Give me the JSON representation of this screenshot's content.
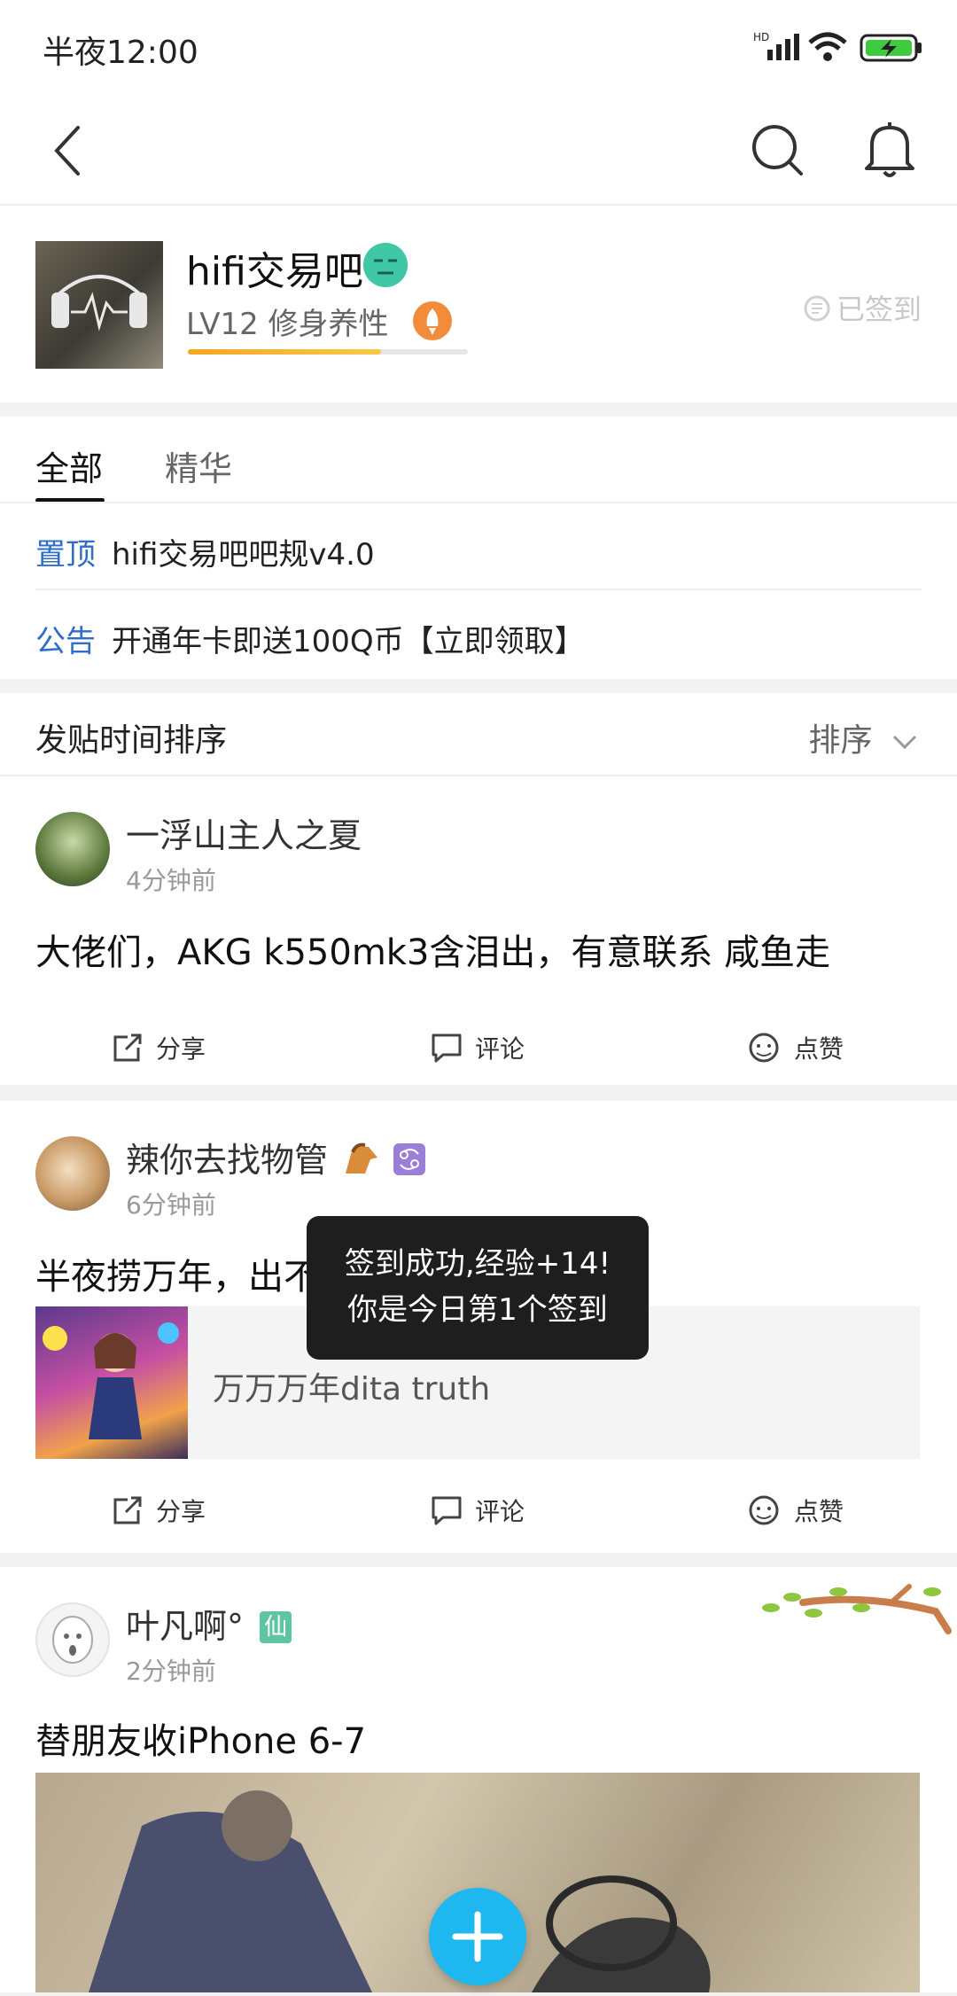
{
  "status": {
    "time": "半夜12:00"
  },
  "forum": {
    "name": "hifi交易吧",
    "level": "LV12 修身养性",
    "signed_label": "已签到"
  },
  "tabs": [
    {
      "label": "全部"
    },
    {
      "label": "精华"
    }
  ],
  "notices": [
    {
      "tag": "置顶",
      "text": "hifi交易吧吧规v4.0"
    },
    {
      "tag": "公告",
      "text": "开通年卡即送100Q币【立即领取】"
    }
  ],
  "sort": {
    "label": "发贴时间排序",
    "button": "排序"
  },
  "posts": [
    {
      "user": "一浮山主人之夏",
      "time": "4分钟前",
      "title": "大佬们，AKG k550mk3含泪出，有意联系 咸鱼走",
      "actions": {
        "share": "分享",
        "comment": "评论",
        "like": "点赞"
      }
    },
    {
      "user": "辣你去找物管",
      "time": "6分钟前",
      "title": "半夜捞万年，出不掉我也认",
      "link_text": "万万万年dita truth",
      "actions": {
        "share": "分享",
        "comment": "评论",
        "like": "点赞"
      }
    },
    {
      "user": "叶凡啊°",
      "badge": "仙",
      "time": "2分钟前",
      "title": "替朋友收iPhone 6-7"
    }
  ],
  "toast": {
    "line1": "签到成功,经验+14!",
    "line2": "你是今日第1个签到"
  },
  "colors": {
    "accent": "#2f6dc9",
    "fab": "#1fb7ef"
  }
}
